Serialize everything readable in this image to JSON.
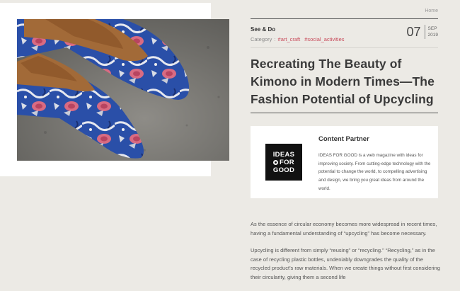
{
  "breadcrumb": {
    "home": "Home"
  },
  "hero": {
    "image_alt": "Pointed shoes made from blue and red floral kimono fabric on concrete floor"
  },
  "article": {
    "section": "See & Do",
    "category_label": "Category",
    "category_sep": ":",
    "tags": [
      "#art_craft",
      "#social_activities"
    ],
    "date": {
      "day": "07",
      "month": "SEP",
      "year": "2019"
    },
    "title": "Recreating The Beauty of Kimono in Modern Times—The Fashion Potential of Upcycling"
  },
  "partner": {
    "heading": "Content Partner",
    "logo_line1": "IDEAS",
    "logo_line2": "FOR",
    "logo_line3": "GOOD",
    "description": "IDEAS FOR GOOD is a web magazine with ideas for improving society. From cutting-edge technology with the potential to change the world, to compelling advertising and design, we bring you great ideas from around the world."
  },
  "body": {
    "paragraph1": "As the essence of circular economy becomes more widespread in recent times, having a fundamental understanding of “upcycling” has become necessary.",
    "paragraph2": "Upcycling is different from simply “reusing” or “recycling.” “Recycling,” as in the case of recycling plastic bottles, undeniably downgrades the quality of the recycled product’s raw materials. When we create things without first considering their circularity, giving them a second life"
  },
  "colors": {
    "tag": "#c84a5a",
    "background": "#eceae5",
    "logo": "#111111"
  }
}
